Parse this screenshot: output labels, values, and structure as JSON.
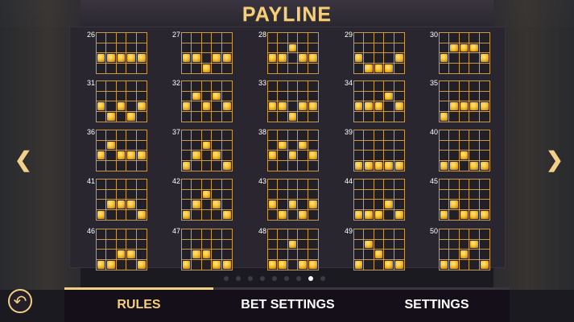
{
  "title": "PAYLINE",
  "paylines": [
    {
      "num": "26",
      "pattern": [
        [
          0,
          0,
          0,
          0,
          0
        ],
        [
          0,
          0,
          0,
          0,
          0
        ],
        [
          1,
          1,
          1,
          1,
          1
        ],
        [
          0,
          0,
          0,
          0,
          0
        ]
      ]
    },
    {
      "num": "27",
      "pattern": [
        [
          0,
          0,
          0,
          0,
          0
        ],
        [
          0,
          0,
          0,
          0,
          0
        ],
        [
          1,
          1,
          0,
          1,
          1
        ],
        [
          0,
          0,
          1,
          0,
          0
        ]
      ]
    },
    {
      "num": "28",
      "pattern": [
        [
          0,
          0,
          0,
          0,
          0
        ],
        [
          0,
          0,
          1,
          0,
          0
        ],
        [
          1,
          1,
          0,
          1,
          1
        ],
        [
          0,
          0,
          0,
          0,
          0
        ]
      ]
    },
    {
      "num": "29",
      "pattern": [
        [
          0,
          0,
          0,
          0,
          0
        ],
        [
          0,
          0,
          0,
          0,
          0
        ],
        [
          1,
          0,
          0,
          0,
          1
        ],
        [
          0,
          1,
          1,
          1,
          0
        ]
      ]
    },
    {
      "num": "30",
      "pattern": [
        [
          0,
          0,
          0,
          0,
          0
        ],
        [
          0,
          1,
          1,
          1,
          0
        ],
        [
          1,
          0,
          0,
          0,
          1
        ],
        [
          0,
          0,
          0,
          0,
          0
        ]
      ]
    },
    {
      "num": "31",
      "pattern": [
        [
          0,
          0,
          0,
          0,
          0
        ],
        [
          0,
          0,
          0,
          0,
          0
        ],
        [
          1,
          0,
          1,
          0,
          1
        ],
        [
          0,
          1,
          0,
          1,
          0
        ]
      ]
    },
    {
      "num": "32",
      "pattern": [
        [
          0,
          0,
          0,
          0,
          0
        ],
        [
          0,
          1,
          0,
          1,
          0
        ],
        [
          1,
          0,
          1,
          0,
          1
        ],
        [
          0,
          0,
          0,
          0,
          0
        ]
      ]
    },
    {
      "num": "33",
      "pattern": [
        [
          0,
          0,
          0,
          0,
          0
        ],
        [
          0,
          0,
          0,
          0,
          0
        ],
        [
          1,
          1,
          0,
          1,
          1
        ],
        [
          0,
          0,
          1,
          0,
          0
        ]
      ]
    },
    {
      "num": "34",
      "pattern": [
        [
          0,
          0,
          0,
          0,
          0
        ],
        [
          0,
          0,
          0,
          1,
          0
        ],
        [
          1,
          1,
          1,
          0,
          1
        ],
        [
          0,
          0,
          0,
          0,
          0
        ]
      ]
    },
    {
      "num": "35",
      "pattern": [
        [
          0,
          0,
          0,
          0,
          0
        ],
        [
          0,
          0,
          0,
          0,
          0
        ],
        [
          0,
          1,
          1,
          1,
          1
        ],
        [
          1,
          0,
          0,
          0,
          0
        ]
      ]
    },
    {
      "num": "36",
      "pattern": [
        [
          0,
          0,
          0,
          0,
          0
        ],
        [
          0,
          1,
          0,
          0,
          0
        ],
        [
          1,
          0,
          1,
          1,
          1
        ],
        [
          0,
          0,
          0,
          0,
          0
        ]
      ]
    },
    {
      "num": "37",
      "pattern": [
        [
          0,
          0,
          0,
          0,
          0
        ],
        [
          0,
          0,
          1,
          0,
          0
        ],
        [
          0,
          1,
          0,
          1,
          0
        ],
        [
          1,
          0,
          0,
          0,
          1
        ]
      ]
    },
    {
      "num": "38",
      "pattern": [
        [
          0,
          0,
          0,
          0,
          0
        ],
        [
          0,
          1,
          0,
          1,
          0
        ],
        [
          1,
          0,
          1,
          0,
          1
        ],
        [
          0,
          0,
          0,
          0,
          0
        ]
      ]
    },
    {
      "num": "39",
      "pattern": [
        [
          0,
          0,
          0,
          0,
          0
        ],
        [
          0,
          0,
          0,
          0,
          0
        ],
        [
          0,
          0,
          0,
          0,
          0
        ],
        [
          1,
          1,
          1,
          1,
          1
        ]
      ]
    },
    {
      "num": "40",
      "pattern": [
        [
          0,
          0,
          0,
          0,
          0
        ],
        [
          0,
          0,
          0,
          0,
          0
        ],
        [
          0,
          0,
          1,
          0,
          0
        ],
        [
          1,
          1,
          0,
          1,
          1
        ]
      ]
    },
    {
      "num": "41",
      "pattern": [
        [
          0,
          0,
          0,
          0,
          0
        ],
        [
          0,
          0,
          0,
          0,
          0
        ],
        [
          0,
          1,
          1,
          1,
          0
        ],
        [
          1,
          0,
          0,
          0,
          1
        ]
      ]
    },
    {
      "num": "42",
      "pattern": [
        [
          0,
          0,
          0,
          0,
          0
        ],
        [
          0,
          0,
          1,
          0,
          0
        ],
        [
          0,
          1,
          0,
          1,
          0
        ],
        [
          1,
          0,
          0,
          0,
          1
        ]
      ]
    },
    {
      "num": "43",
      "pattern": [
        [
          0,
          0,
          0,
          0,
          0
        ],
        [
          0,
          0,
          0,
          0,
          0
        ],
        [
          1,
          0,
          1,
          0,
          1
        ],
        [
          0,
          1,
          0,
          1,
          0
        ]
      ]
    },
    {
      "num": "44",
      "pattern": [
        [
          0,
          0,
          0,
          0,
          0
        ],
        [
          0,
          0,
          0,
          0,
          0
        ],
        [
          0,
          0,
          0,
          1,
          0
        ],
        [
          1,
          1,
          1,
          0,
          1
        ]
      ]
    },
    {
      "num": "45",
      "pattern": [
        [
          0,
          0,
          0,
          0,
          0
        ],
        [
          0,
          0,
          0,
          0,
          0
        ],
        [
          0,
          1,
          0,
          0,
          0
        ],
        [
          1,
          0,
          1,
          1,
          1
        ]
      ]
    },
    {
      "num": "46",
      "pattern": [
        [
          0,
          0,
          0,
          0,
          0
        ],
        [
          0,
          0,
          0,
          0,
          0
        ],
        [
          0,
          0,
          1,
          1,
          0
        ],
        [
          1,
          1,
          0,
          0,
          1
        ]
      ]
    },
    {
      "num": "47",
      "pattern": [
        [
          0,
          0,
          0,
          0,
          0
        ],
        [
          0,
          0,
          0,
          0,
          0
        ],
        [
          0,
          1,
          1,
          0,
          0
        ],
        [
          1,
          0,
          0,
          1,
          1
        ]
      ]
    },
    {
      "num": "48",
      "pattern": [
        [
          0,
          0,
          0,
          0,
          0
        ],
        [
          0,
          0,
          1,
          0,
          0
        ],
        [
          0,
          0,
          0,
          0,
          0
        ],
        [
          1,
          1,
          0,
          1,
          1
        ]
      ]
    },
    {
      "num": "49",
      "pattern": [
        [
          0,
          0,
          0,
          0,
          0
        ],
        [
          0,
          1,
          0,
          0,
          0
        ],
        [
          0,
          0,
          1,
          0,
          0
        ],
        [
          1,
          0,
          0,
          1,
          1
        ]
      ]
    },
    {
      "num": "50",
      "pattern": [
        [
          0,
          0,
          0,
          0,
          0
        ],
        [
          0,
          0,
          0,
          1,
          0
        ],
        [
          0,
          0,
          1,
          0,
          0
        ],
        [
          1,
          1,
          0,
          0,
          1
        ]
      ]
    }
  ],
  "page_dots": {
    "count": 9,
    "active_index": 7
  },
  "tabs": [
    {
      "label": "RULES",
      "active": true
    },
    {
      "label": "BET SETTINGS",
      "active": false
    },
    {
      "label": "SETTINGS",
      "active": false
    }
  ],
  "icons": {
    "prev": "chevron-left-icon",
    "next": "chevron-right-icon",
    "back": "back-arrow-icon"
  },
  "colors": {
    "accent": "#f6cf7d",
    "grid": "#c99a45",
    "symbol": "#f7c12b"
  }
}
